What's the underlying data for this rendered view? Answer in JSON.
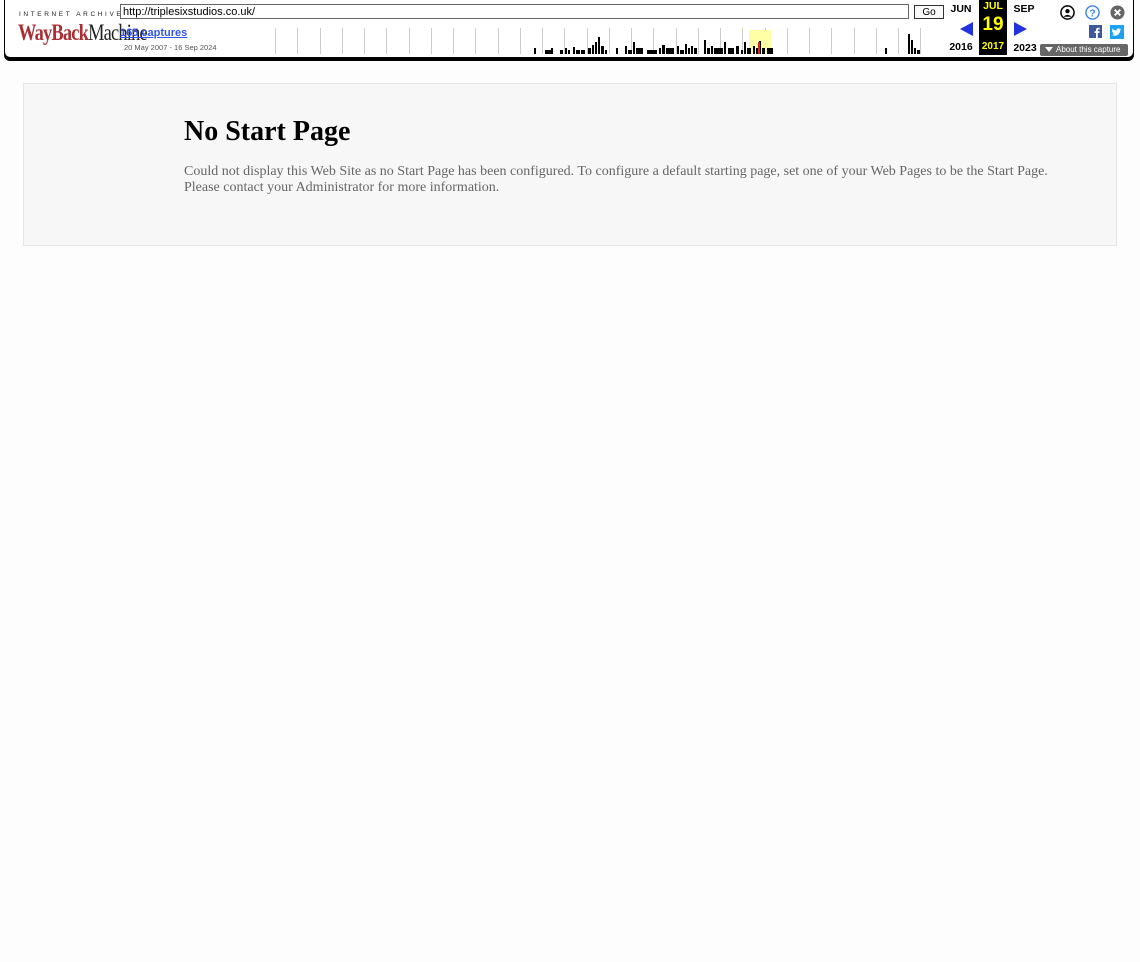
{
  "toolbar": {
    "logo_top": "INTERNET ARCHIVE",
    "logo_wayback": "WayBack",
    "logo_machine": "Machine",
    "url_value": "http://triplesixstudios.co.uk/",
    "go_label": "Go",
    "captures_label": "165 captures",
    "date_range": "20 May 2007 - 16 Sep 2024",
    "prev_month": "JUN",
    "cur_month": "JUL",
    "next_month": "SEP",
    "cur_day": "19",
    "prev_year": "2016",
    "cur_year": "2017",
    "next_year": "2023",
    "about_label": "About this capture",
    "icons": [
      "user-icon",
      "help-icon",
      "close-icon",
      "facebook-icon",
      "twitter-icon"
    ],
    "accent_color": "#2233dd",
    "highlight_color": "#ffff00"
  },
  "content": {
    "title": "No Start Page",
    "message": "Could not display this Web Site as no Start Page has been configured. To configure a default starting page, set one of your Web Pages to be the Start Page. Please contact your Administrator for more information."
  }
}
